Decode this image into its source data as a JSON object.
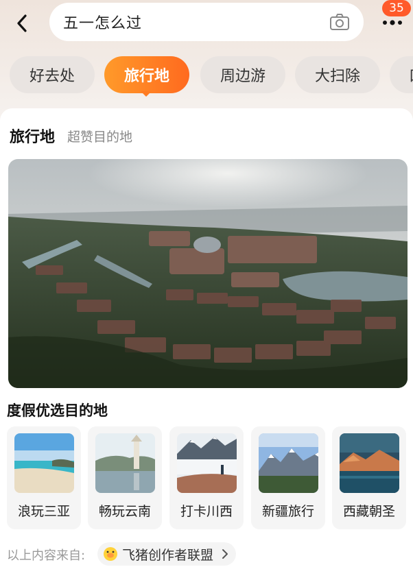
{
  "header": {
    "search_text": "五一怎么过",
    "badge_count": "35"
  },
  "tabs": [
    {
      "label": "好去处",
      "active": false
    },
    {
      "label": "旅行地",
      "active": true
    },
    {
      "label": "周边游",
      "active": false
    },
    {
      "label": "大扫除",
      "active": false
    },
    {
      "label": "口",
      "active": false
    }
  ],
  "section": {
    "title": "旅行地",
    "subtitle": "超赞目的地"
  },
  "subsection": {
    "title": "度假优选目的地"
  },
  "destinations": [
    {
      "label": "浪玩三亚"
    },
    {
      "label": "畅玩云南"
    },
    {
      "label": "打卡川西"
    },
    {
      "label": "新疆旅行"
    },
    {
      "label": "西藏朝圣"
    }
  ],
  "source": {
    "label": "以上内容来自:",
    "name": "飞猪创作者联盟"
  },
  "colors": {
    "accent": "#ff6a1f",
    "badge": "#ff5a2a"
  }
}
